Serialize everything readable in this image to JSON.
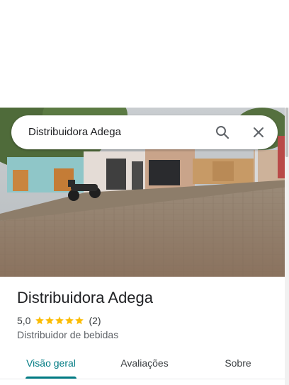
{
  "search": {
    "query": "Distribuidora Adega",
    "icons": [
      "search-icon",
      "close-icon"
    ]
  },
  "place": {
    "name": "Distribuidora Adega",
    "rating": "5,0",
    "stars": 5,
    "reviews_count": "(2)",
    "category": "Distribuidor de bebidas"
  },
  "tabs": [
    {
      "label": "Visão geral",
      "selected": true
    },
    {
      "label": "Avaliações",
      "selected": false
    },
    {
      "label": "Sobre",
      "selected": false
    }
  ],
  "colors": {
    "accent": "#007b83",
    "star": "#fbbc04"
  }
}
